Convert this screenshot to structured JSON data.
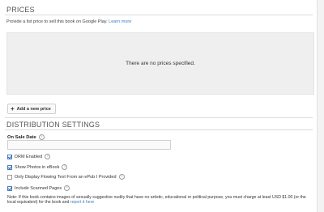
{
  "prices": {
    "title": "PRICES",
    "help_text": "Provide a list price to sell this book on Google Play.",
    "learn_more": "Learn more",
    "empty_message": "There are no prices specified.",
    "add_button": "Add a new price"
  },
  "distribution": {
    "title": "DISTRIBUTION SETTINGS",
    "on_sale_date_label": "On Sale Date",
    "on_sale_date_value": "",
    "options": [
      {
        "label": "DRM Enabled",
        "checked": true
      },
      {
        "label": "Show Photos in eBook",
        "checked": true
      },
      {
        "label": "Only Display Flowing Text From an ePub I Provided",
        "checked": false
      },
      {
        "label": "Include Scanned Pages",
        "checked": true
      }
    ],
    "note_text": "Note: If this book contains images of sexually suggestive nudity that have no artistic, educational or political purpose, you must charge at least USD $1.00 (or the local equivalent) for the book and",
    "note_link": "report it here"
  },
  "colors": {
    "link": "#3b7dc4",
    "empty_box_bg": "#efefef",
    "checkbox_check": "#2a5faa"
  }
}
